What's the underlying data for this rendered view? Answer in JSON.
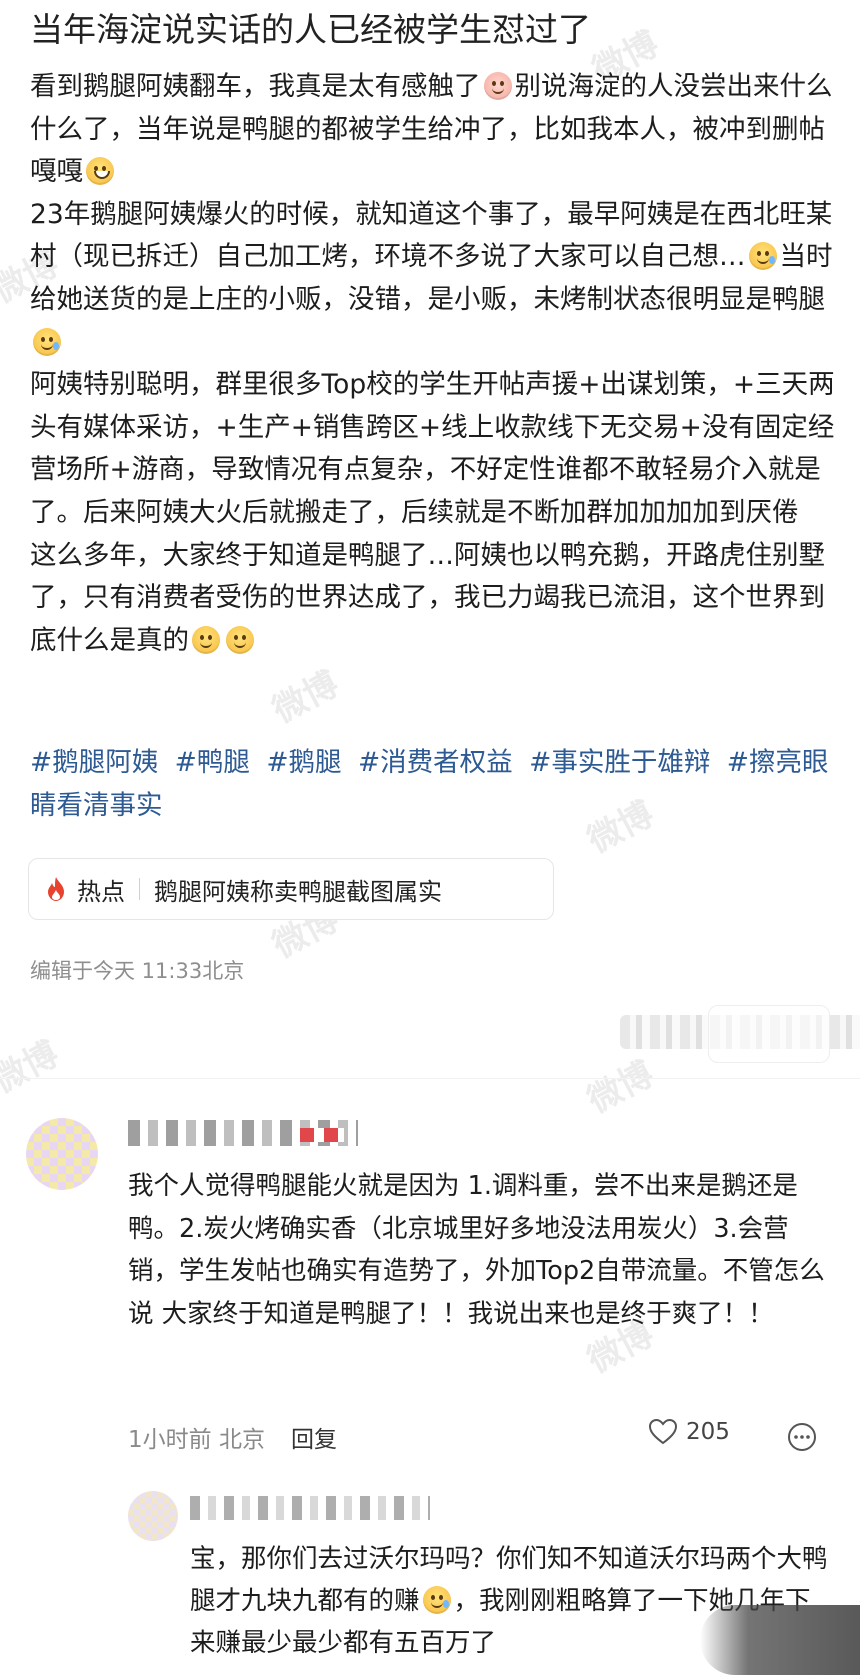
{
  "post": {
    "title": "当年海淀说实话的人已经被学生怼过了",
    "paragraphs": [
      "看到鹅腿阿姨翻车，我真是太有感触了",
      "别说海淀的人没尝出来什么什么了，当年说是鸭腿的都被学生给冲了，比如我本人，被冲到删帖 嘎嘎",
      "23年鹅腿阿姨爆火的时候，就知道这个事了，最早阿姨是在西北旺某村（现已拆迁）自己加工烤，环境不多说了大家可以自己想…",
      "当时给她送货的是上庄的小贩，没错，是小贩，未烤制状态很明显是鸭腿",
      "阿姨特别聪明，群里很多Top校的学生开帖声援+出谋划策，+三天两头有媒体采访，+生产+销售跨区+线上收款线下无交易+没有固定经营场所+游商，导致情况有点复杂，不好定性谁都不敢轻易介入就是了。后来阿姨大火后就搬走了，后续就是不断加群加加加加到厌倦",
      "这么多年，大家终于知道是鸭腿了…阿姨也以鸭充鹅，开路虎住别墅了，只有消费者受伤的世界达成了，我已力竭我已流泪，这个世界到底什么是真的"
    ],
    "tags": [
      "#鹅腿阿姨",
      "#鸭腿",
      "#鹅腿",
      "#消费者权益",
      "#事实胜于雄辩",
      "#擦亮眼睛看清事实"
    ],
    "hot_label": "热点",
    "hot_text": "鹅腿阿姨称卖鸭腿截图属实",
    "edited": "编辑于今天 11:33北京"
  },
  "comment": {
    "text": "我个人觉得鸭腿能火就是因为 1.调料重，尝不出来是鹅还是鸭。2.炭火烤确实香（北京城里好多地没法用炭火）3.会营销，学生发帖也确实有造势了，外加Top2自带流量。不管怎么说 大家终于知道是鸭腿了！！我说出来也是终于爽了！！",
    "time": "1小时前 北京",
    "reply_label": "回复",
    "likes": "205"
  },
  "reply": {
    "text_a": "宝，那你们去过沃尔玛吗？你们知不知道沃尔玛两个大鸭腿才九块九都有的赚",
    "text_b": "，我刚刚粗略算了一下她几年下来赚最少最少都有五百万了"
  },
  "watermark": "微博",
  "colors": {
    "tag": "#2d5a93",
    "hot": "#e8432e",
    "meta": "#8e8e8e"
  },
  "icons": [
    "flame-icon",
    "heart-icon",
    "more-icon",
    "emoji-icon"
  ]
}
